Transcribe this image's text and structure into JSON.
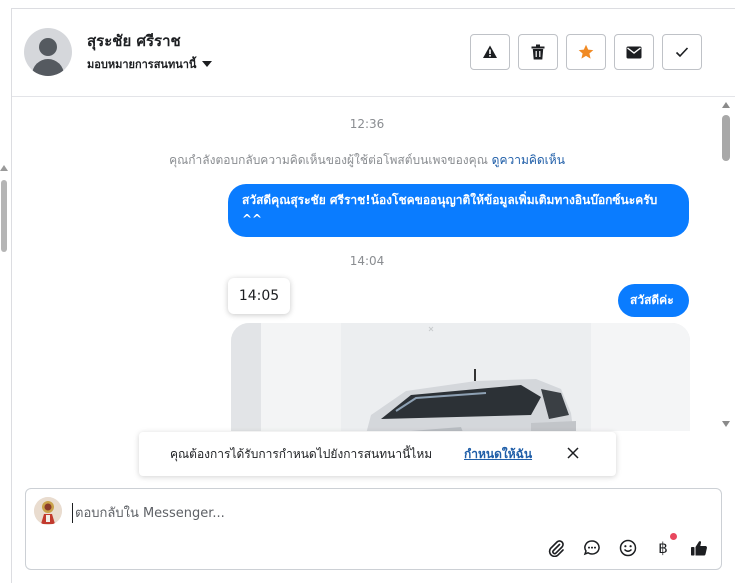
{
  "contact": {
    "name": "สุระชัย ศรีราช",
    "assign_label": "มอบหมายการสนทนานี้"
  },
  "header_actions": [
    {
      "icon": "warning-icon",
      "label": "Mark as spam"
    },
    {
      "icon": "trash-icon",
      "label": "Delete"
    },
    {
      "icon": "star-icon",
      "label": "Star"
    },
    {
      "icon": "envelope-icon",
      "label": "Mark as unread"
    },
    {
      "icon": "check-icon",
      "label": "Mark as done"
    }
  ],
  "colors": {
    "outgoing_bubble": "#0a7cff",
    "star_active": "#f08a24",
    "link": "#1f5ea8",
    "notification_dot": "#e8475e"
  },
  "messages": {
    "time_1": "12:36",
    "notice_text": "คุณกำลังตอบกลับความคิดเห็นของผู้ใช้ต่อโพสต์บนเพจของคุณ",
    "notice_link": "ดูความคิดเห็น",
    "bubble_1": "สวัสดีคุณสุระชัย ศรีราช!น้องโชคขออนุญาติให้ข้อมูลเพิ่มเติมทางอินบ๊อกซ์นะครับ ^^",
    "time_2": "14:04",
    "tooltip_time": "14:05",
    "bubble_2": "สวัสดีค่ะ"
  },
  "banner": {
    "text": "คุณต้องการได้รับการกำหนดไปยังการสนทนานี้ไหม",
    "link": "กำหนดให้ฉัน"
  },
  "composer": {
    "placeholder": "ตอบกลับใน Messenger...",
    "baht_symbol": "฿"
  }
}
